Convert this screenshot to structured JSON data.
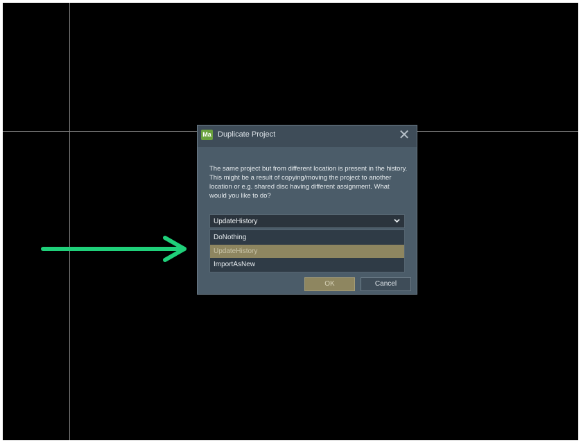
{
  "dialog": {
    "title": "Duplicate Project",
    "app_icon_label": "Ma",
    "close_glyph": "✕",
    "message": "The same project but from different location is present in the history. This might be a result of copying/moving the project to another location or e.g. shared disc having different assignment. What would you like to do?",
    "select": {
      "value": "UpdateHistory",
      "options": [
        "DoNothing",
        "UpdateHistory",
        "ImportAsNew"
      ]
    },
    "buttons": {
      "ok": "OK",
      "cancel": "Cancel"
    }
  },
  "annotation": {
    "color": "#1fd07a"
  },
  "colors": {
    "accent": "#8e8660",
    "dialog_bg": "#4b5c69",
    "app_icon": "#6aa23e"
  }
}
